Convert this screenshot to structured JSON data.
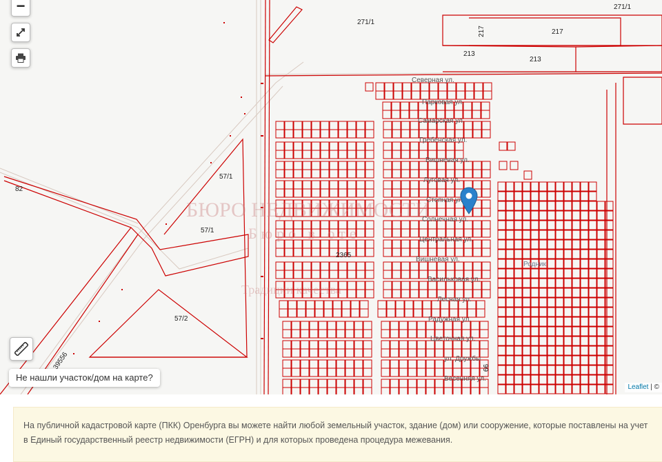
{
  "map": {
    "parcels": [
      "271/1",
      "271/1",
      "217",
      "217",
      "213",
      "213",
      "82",
      "57/1",
      "57/1",
      "57/2",
      "2365",
      "66",
      "39556"
    ],
    "streets": [
      "Северная ул.",
      "Парковая ул.",
      "Самарская ул.",
      "Гребенская ул.",
      "Вишневая ул.",
      "Луговая ул.",
      "Степная ул.",
      "Солнечная ул.",
      "Центральная ул.",
      "Вишневая ул.",
      "Васильковая ул.",
      "Лесная ул.",
      "Радужная ул.",
      "Цветочная ул.",
      "ул. Дружбы",
      "Весенняя ул."
    ],
    "place_label": "Родник",
    "watermark": {
      "line1": "БЮРО НЕДВИЖИМОСТИ",
      "line2": "Бюро в оте",
      "line3": "Традиции качества"
    },
    "parcel_color": "#cc0000",
    "marker_color": "#2a81cb"
  },
  "controls": {
    "zoom_out_label": "−",
    "fullscreen_icon": "expand-icon",
    "print_icon": "printer-icon",
    "ruler_icon": "ruler-icon",
    "not_found_label": "Не нашли участок/дом на карте?"
  },
  "attribution": {
    "leaflet": "Leaflet",
    "sep": " | ©"
  },
  "info": {
    "line1": "На публичной кадастровой карте (ПКК) Оренбурга вы можете найти любой земельный участок, здание (дом) или сооружение, которые поставлены на учет",
    "line2": "в Единый государственный реестр недвижимости (ЕГРН) и для которых проведена процедура межевания."
  }
}
